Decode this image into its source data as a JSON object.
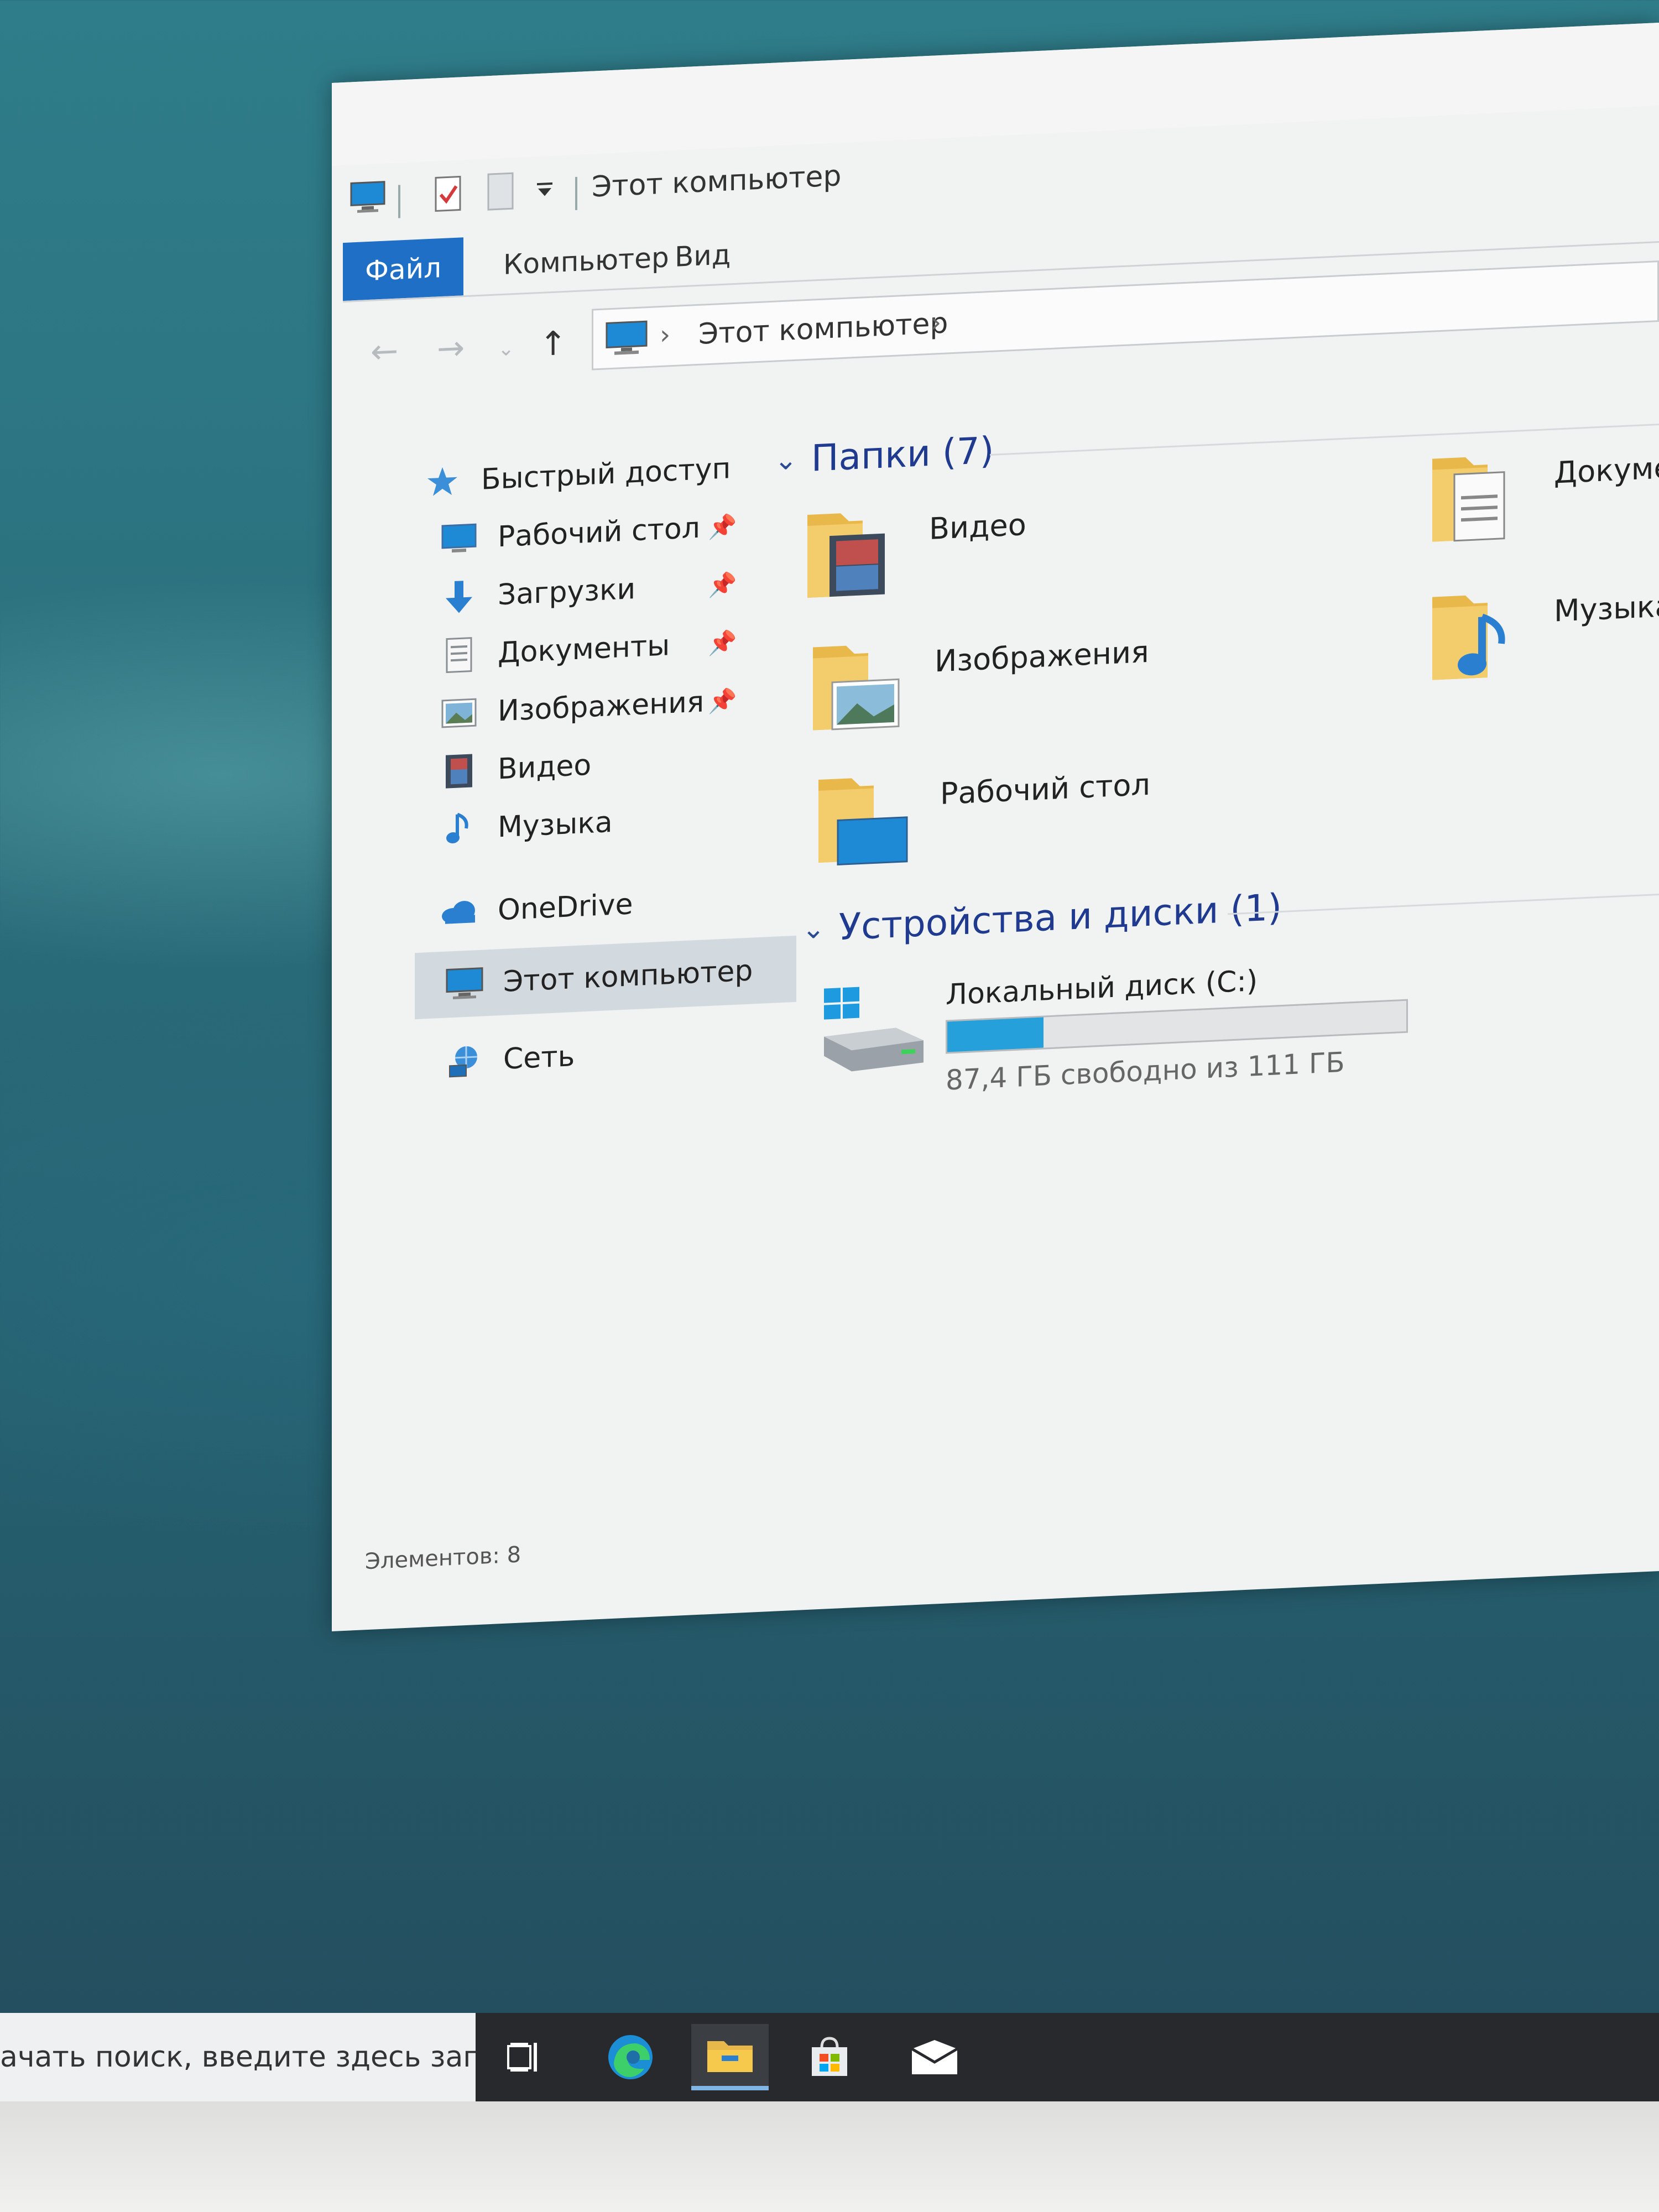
{
  "window": {
    "title": "Этот компьютер",
    "quick_access_icons": [
      "computer-icon",
      "properties-check-icon",
      "new-folder-icon",
      "customize-arrow-icon"
    ]
  },
  "ribbon": {
    "tabs": [
      "Файл",
      "Компьютер",
      "Вид"
    ]
  },
  "address_bar": {
    "path": "Этот компьютер"
  },
  "sidebar": {
    "quick_access": "Быстрый доступ",
    "items": [
      {
        "label": "Рабочий стол",
        "icon": "desktop-icon",
        "pinned": true
      },
      {
        "label": "Загрузки",
        "icon": "download-icon",
        "pinned": true
      },
      {
        "label": "Документы",
        "icon": "documents-icon",
        "pinned": true
      },
      {
        "label": "Изображения",
        "icon": "pictures-icon",
        "pinned": true
      },
      {
        "label": "Видео",
        "icon": "video-icon",
        "pinned": false
      },
      {
        "label": "Музыка",
        "icon": "music-icon",
        "pinned": false
      }
    ],
    "onedrive": "OneDrive",
    "this_pc": "Этот компьютер",
    "network": "Сеть"
  },
  "content": {
    "folders_header": "Папки (7)",
    "folders": [
      {
        "name": "Видео",
        "icon": "video-folder-icon"
      },
      {
        "name": "Изображения",
        "icon": "pictures-folder-icon"
      },
      {
        "name": "Рабочий стол",
        "icon": "desktop-folder-icon"
      },
      {
        "name": "Докуме",
        "icon": "documents-folder-icon"
      },
      {
        "name": "Музыка",
        "icon": "music-folder-icon"
      }
    ],
    "devices_header": "Устройства и диски (1)",
    "drive": {
      "name": "Локальный диск (C:)",
      "free_text": "87,4 ГБ свободно из 111 ГБ",
      "used_fraction": 0.21,
      "bar_color": "#26a0da"
    }
  },
  "status": {
    "items_count": "Элементов: 8"
  },
  "taskbar": {
    "search_placeholder": "ачать поиск, введите здесь запрос",
    "buttons": [
      "task-view-icon",
      "edge-icon",
      "file-explorer-icon",
      "store-icon",
      "mail-icon"
    ]
  }
}
